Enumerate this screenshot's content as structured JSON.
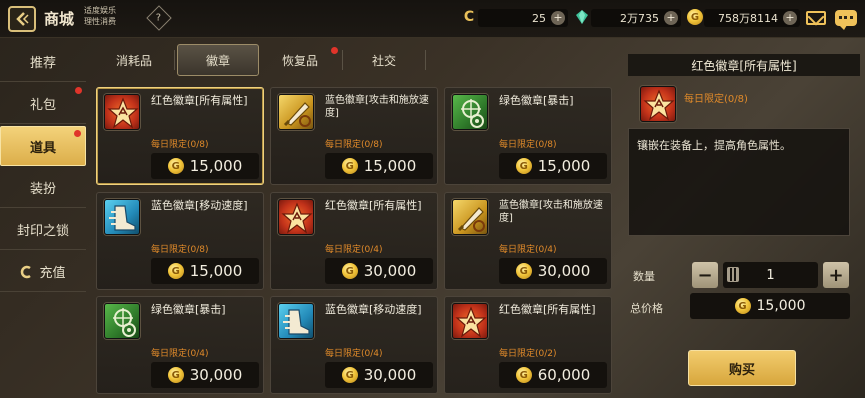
{
  "header": {
    "title": "商城",
    "subnote_line1": "适度娱乐",
    "subnote_line2": "理性消费",
    "help": "?",
    "currencies": [
      {
        "icon": "c-token-icon",
        "value": "25",
        "color": "#e8c05a"
      },
      {
        "icon": "green-gem-icon",
        "value": "2万735",
        "color": "#3fc29a"
      },
      {
        "icon": "gold-coin-icon",
        "value": "758万8114",
        "color": "#f2c53a"
      }
    ]
  },
  "sidebar": {
    "items": [
      {
        "label": "推荐"
      },
      {
        "label": "礼包"
      },
      {
        "label": "道具"
      },
      {
        "label": "装扮"
      },
      {
        "label": "封印之锁"
      },
      {
        "label": "充值"
      }
    ],
    "active_index": 2
  },
  "tabs": {
    "items": [
      {
        "label": "消耗品"
      },
      {
        "label": "徽章"
      },
      {
        "label": "恢复品"
      },
      {
        "label": "社交"
      }
    ],
    "active_index": 1
  },
  "products": [
    {
      "name": "红色徽章[所有属性]",
      "limit": "每日限定(0/8)",
      "price": "15,000",
      "color": "red"
    },
    {
      "name": "蓝色徽章[攻击和施放速度]",
      "limit": "每日限定(0/8)",
      "price": "15,000",
      "color": "yellow"
    },
    {
      "name": "绿色徽章[暴击]",
      "limit": "每日限定(0/8)",
      "price": "15,000",
      "color": "green"
    },
    {
      "name": "蓝色徽章[移动速度]",
      "limit": "每日限定(0/8)",
      "price": "15,000",
      "color": "blue"
    },
    {
      "name": "红色徽章[所有属性]",
      "limit": "每日限定(0/4)",
      "price": "30,000",
      "color": "red"
    },
    {
      "name": "蓝色徽章[攻击和施放速度]",
      "limit": "每日限定(0/4)",
      "price": "30,000",
      "color": "yellow"
    },
    {
      "name": "绿色徽章[暴击]",
      "limit": "每日限定(0/4)",
      "price": "30,000",
      "color": "green"
    },
    {
      "name": "蓝色徽章[移动速度]",
      "limit": "每日限定(0/4)",
      "price": "30,000",
      "color": "blue"
    },
    {
      "name": "红色徽章[所有属性]",
      "limit": "每日限定(0/2)",
      "price": "60,000",
      "color": "red"
    }
  ],
  "detail": {
    "title": "红色徽章[所有属性]",
    "limit": "每日限定(0/8)",
    "description": "镶嵌在装备上，提高角色属性。",
    "qty_label": "数量",
    "qty_value": "1",
    "minus": "−",
    "plus": "+",
    "total_label": "总价格",
    "total_price": "15,000",
    "buy_label": "购买"
  }
}
